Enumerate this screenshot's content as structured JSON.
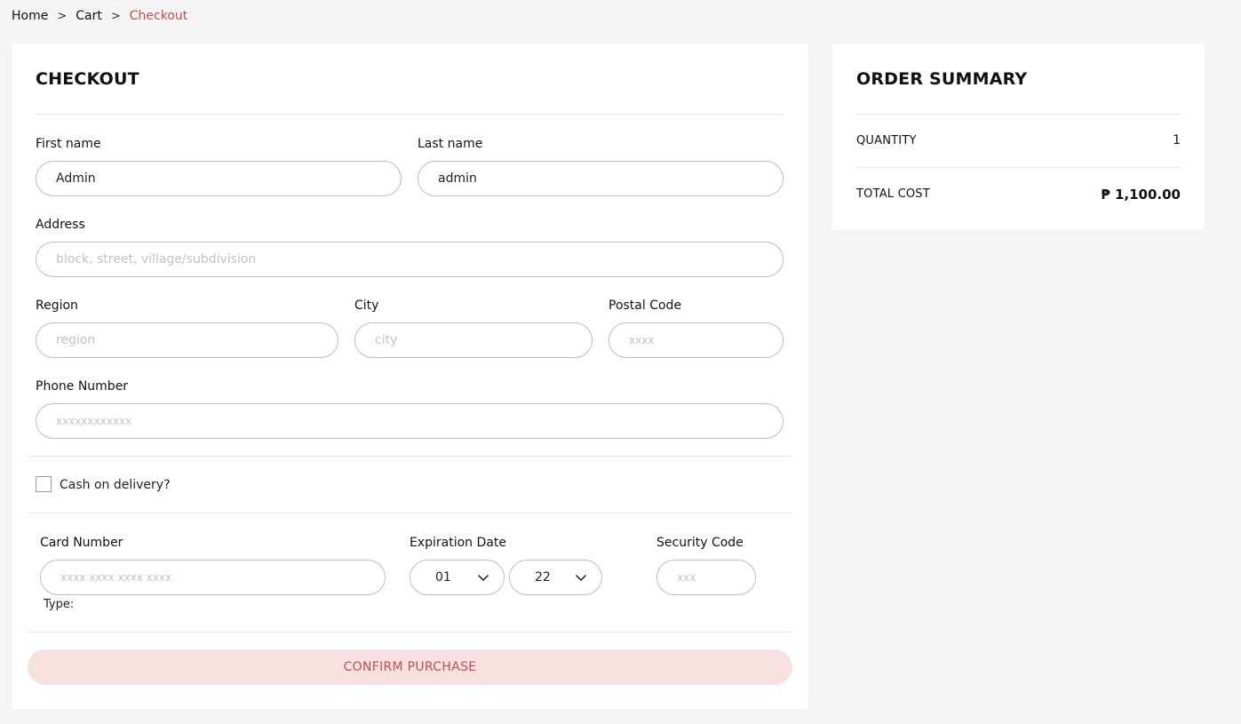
{
  "breadcrumb": {
    "home": "Home",
    "cart": "Cart",
    "current": "Checkout",
    "separator": ">"
  },
  "checkout": {
    "title": "CHECKOUT",
    "first_name": {
      "label": "First name",
      "value": "Admin",
      "placeholder": ""
    },
    "last_name": {
      "label": "Last name",
      "value": "admin",
      "placeholder": ""
    },
    "address": {
      "label": "Address",
      "value": "",
      "placeholder": "block, street, village/subdivision"
    },
    "region": {
      "label": "Region",
      "value": "",
      "placeholder": "region"
    },
    "city": {
      "label": "City",
      "value": "",
      "placeholder": "city"
    },
    "postal_code": {
      "label": "Postal Code",
      "value": "",
      "placeholder": "xxxx"
    },
    "phone": {
      "label": "Phone Number",
      "value": "",
      "placeholder": "xxxxxxxxxxxx"
    },
    "cod": {
      "label": "Cash on delivery?",
      "checked": false
    },
    "card_number": {
      "label": "Card Number",
      "value": "",
      "placeholder": "xxxx xxxx xxxx xxxx"
    },
    "card_type_label": "Type:",
    "expiration": {
      "label": "Expiration Date",
      "month": "01",
      "year": "22"
    },
    "security_code": {
      "label": "Security Code",
      "value": "",
      "placeholder": "xxx"
    },
    "confirm_label": "CONFIRM PURCHASE"
  },
  "summary": {
    "title": "ORDER SUMMARY",
    "quantity_label": "QUANTITY",
    "quantity_value": "1",
    "total_label": "TOTAL COST",
    "total_value": "₱ 1,100.00"
  },
  "colors": {
    "accent": "#c0504d",
    "confirm_bg": "#f7e0e0",
    "page_bg": "#f4f4f4",
    "border": "#bdbdbd"
  },
  "icons": {
    "breadcrumb_separator": "chevron-right-icon",
    "select_arrow": "chevron-down-icon"
  }
}
